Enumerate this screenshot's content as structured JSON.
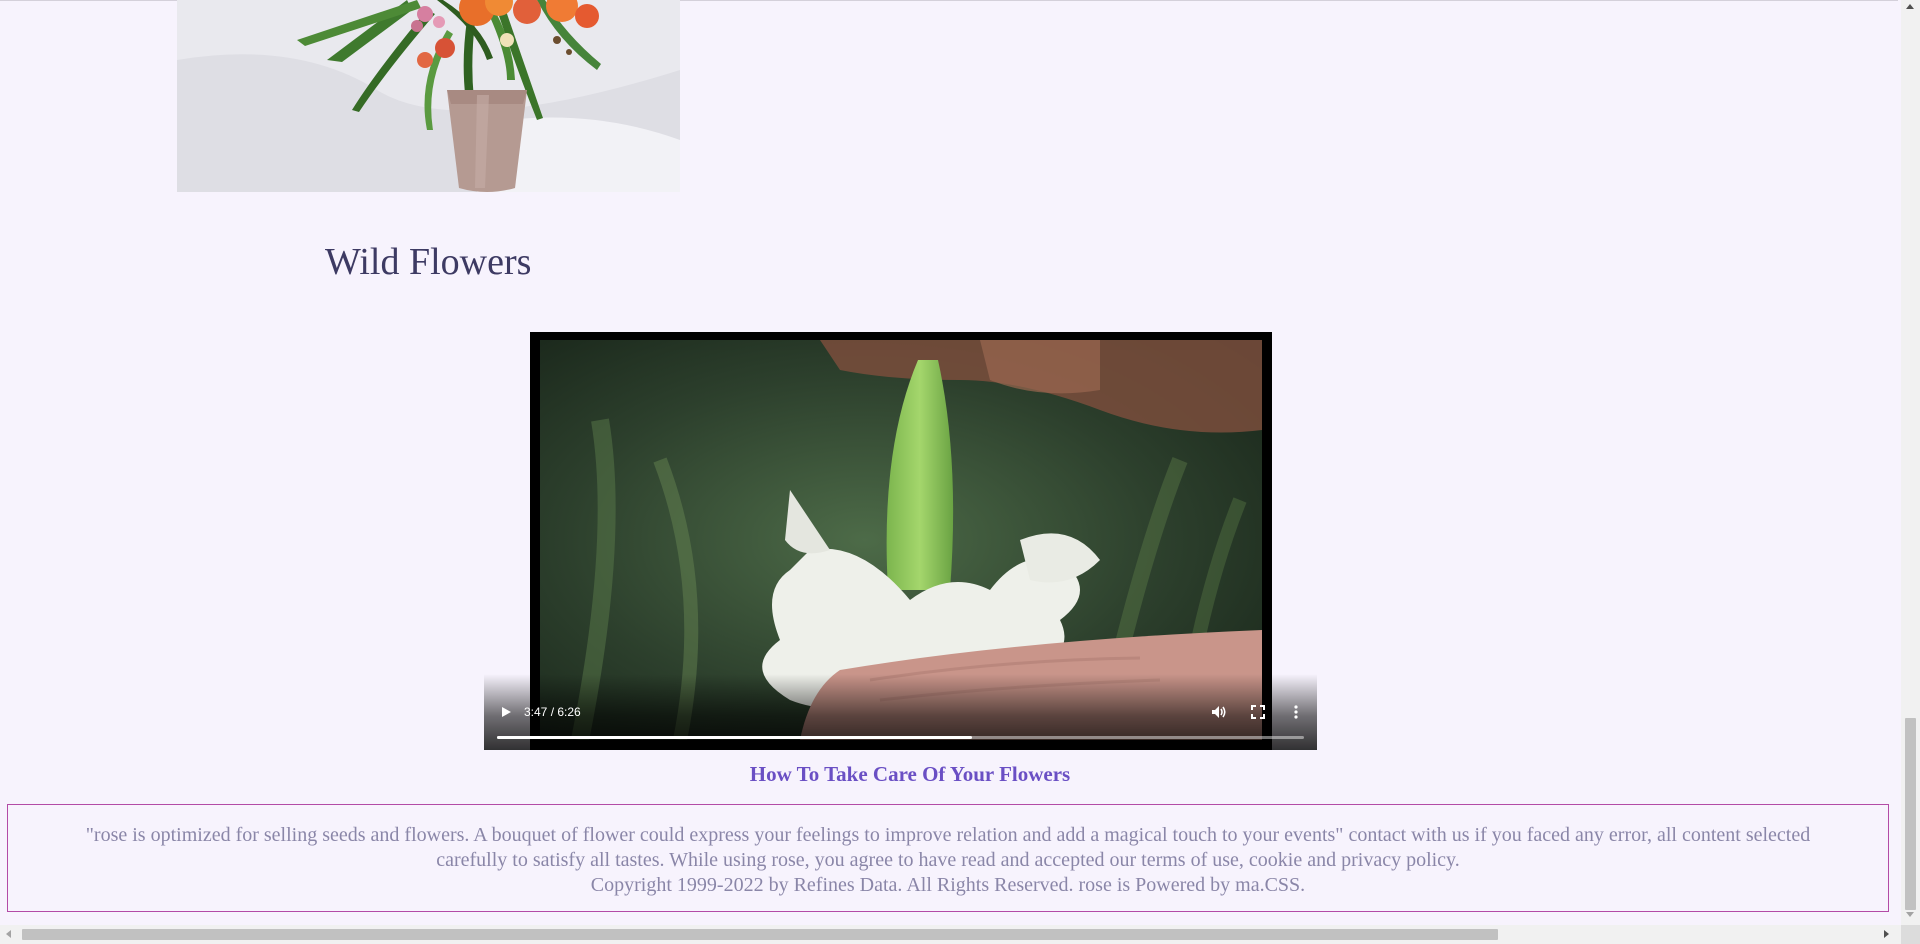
{
  "section": {
    "title": "Wild Flowers"
  },
  "video": {
    "time_readout": "3:47 / 6:26",
    "progress": 0.588,
    "caption": "How To Take Care Of Your Flowers"
  },
  "footer": {
    "line1": "\"rose is optimized for selling seeds and flowers. A bouquet of flower could express your feelings to improve relation and add a magical touch to your events\" contact with us if you faced any error, all content selected",
    "line2": "carefully to satisfy all tastes. While using rose, you agree to have read and accepted our terms of use, cookie and privacy policy.",
    "line3": "Copyright 1999-2022 by Refines Data. All Rights Reserved. rose is Powered by ma.CSS."
  },
  "colors": {
    "background": "#f7f3fd",
    "title": "#3d3a63",
    "caption": "#6a4fc4",
    "footer_text": "#8a86a8",
    "footer_border": "#b34ba6"
  },
  "icons": {
    "play": "play-icon",
    "volume": "volume-icon",
    "fullscreen": "fullscreen-icon",
    "more": "more-vertical-icon"
  }
}
